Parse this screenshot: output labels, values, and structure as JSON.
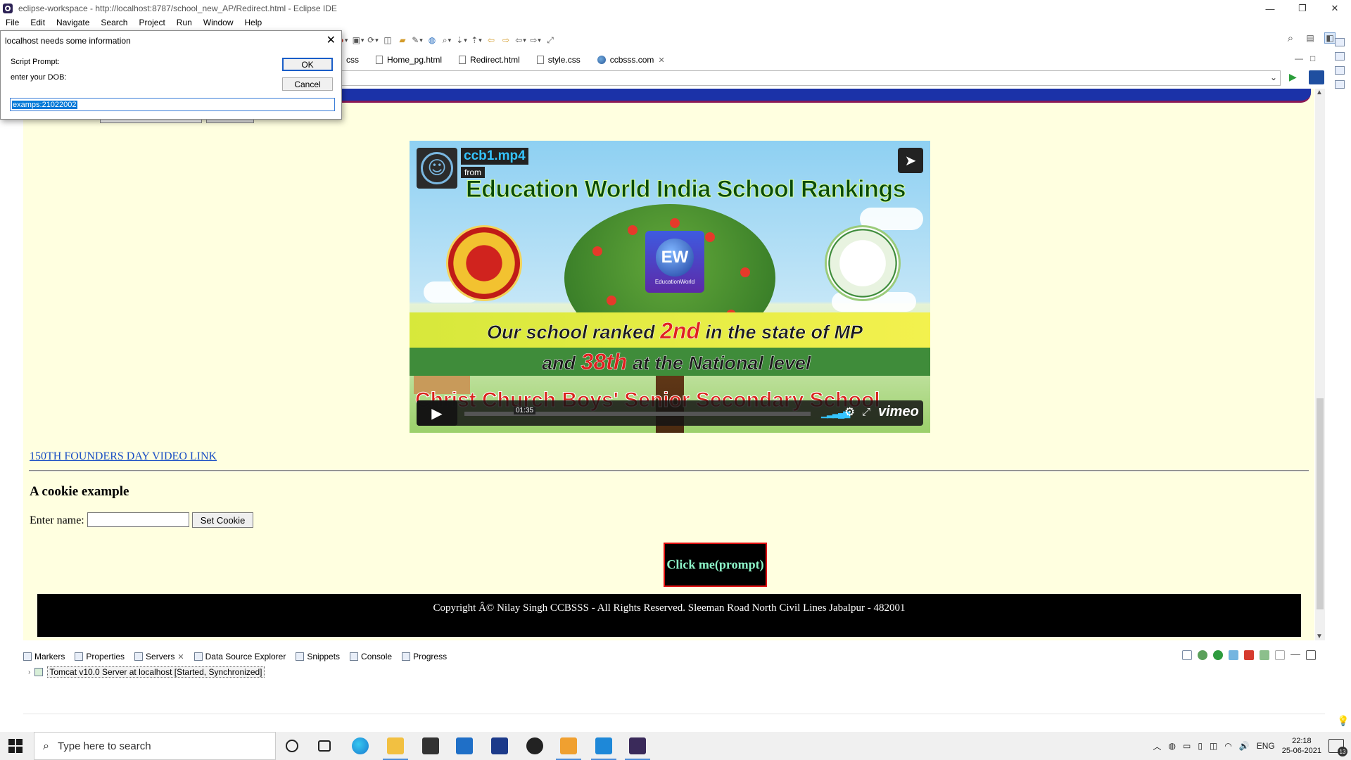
{
  "window": {
    "title": "eclipse-workspace - http://localhost:8787/school_new_AP/Redirect.html - Eclipse IDE",
    "controls": [
      "—",
      "❐",
      "✕"
    ]
  },
  "menu": [
    "File",
    "Edit",
    "Navigate",
    "Search",
    "Project",
    "Run",
    "Window",
    "Help"
  ],
  "tabs": [
    {
      "label": "css"
    },
    {
      "label": "Home_pg.html"
    },
    {
      "label": "Redirect.html"
    },
    {
      "label": "style.css"
    },
    {
      "label": "ccbsss.com",
      "close": "✕",
      "active": true
    }
  ],
  "urlbar": {
    "value": ""
  },
  "page": {
    "video": {
      "name": "ccb1.mp4",
      "from": "from",
      "headline": "Education World India School Rankings",
      "logo_center": "EW",
      "logo_center_caption": "EducationWorld",
      "line1_a": "Our school ranked",
      "line1_b": "2nd",
      "line1_c": "in the state of MP",
      "line2_a": "and",
      "line2_b": "38th",
      "line2_c": "at the National level",
      "line3": "Christ Church Boys' Senior Secondary School",
      "timecode": "01:35",
      "progress": 0.0,
      "brand": "vimeo"
    },
    "founders_link": "150TH FOUNDERS DAY VIDEO LINK",
    "cookie_heading": "A cookie example",
    "name_label": "Enter name:",
    "set_cookie": "Set Cookie",
    "click_me": "Click me(prompt)",
    "footer": "Copyright Â© Nilay Singh CCBSSS - All Rights Reserved. Sleeman Road North Civil Lines Jabalpur - 482001"
  },
  "dialog": {
    "title": "localhost needs some information",
    "close": "✕",
    "prompt_label": "Script Prompt:",
    "message": "enter your DOB:",
    "ok": "OK",
    "cancel": "Cancel",
    "input_value": "examps:21022002"
  },
  "panel": {
    "tabs": [
      {
        "label": "Markers"
      },
      {
        "label": "Properties"
      },
      {
        "label": "Servers",
        "close": "✕"
      },
      {
        "label": "Data Source Explorer"
      },
      {
        "label": "Snippets"
      },
      {
        "label": "Console"
      },
      {
        "label": "Progress"
      }
    ],
    "server": "Tomcat v10.0 Server at localhost  [Started, Synchronized]"
  },
  "taskbar": {
    "search_placeholder": "Type here to search",
    "lang": "ENG",
    "time": "22:18",
    "date": "25-06-2021",
    "notifications": "13"
  },
  "colors": {
    "page_bg": "#ffffe0",
    "footer_bg": "#000000",
    "click_me_text": "#8cf5c8",
    "click_me_border": "#e01010",
    "link": "#1a4fc4",
    "vimeo_accent": "#35c4ff"
  }
}
